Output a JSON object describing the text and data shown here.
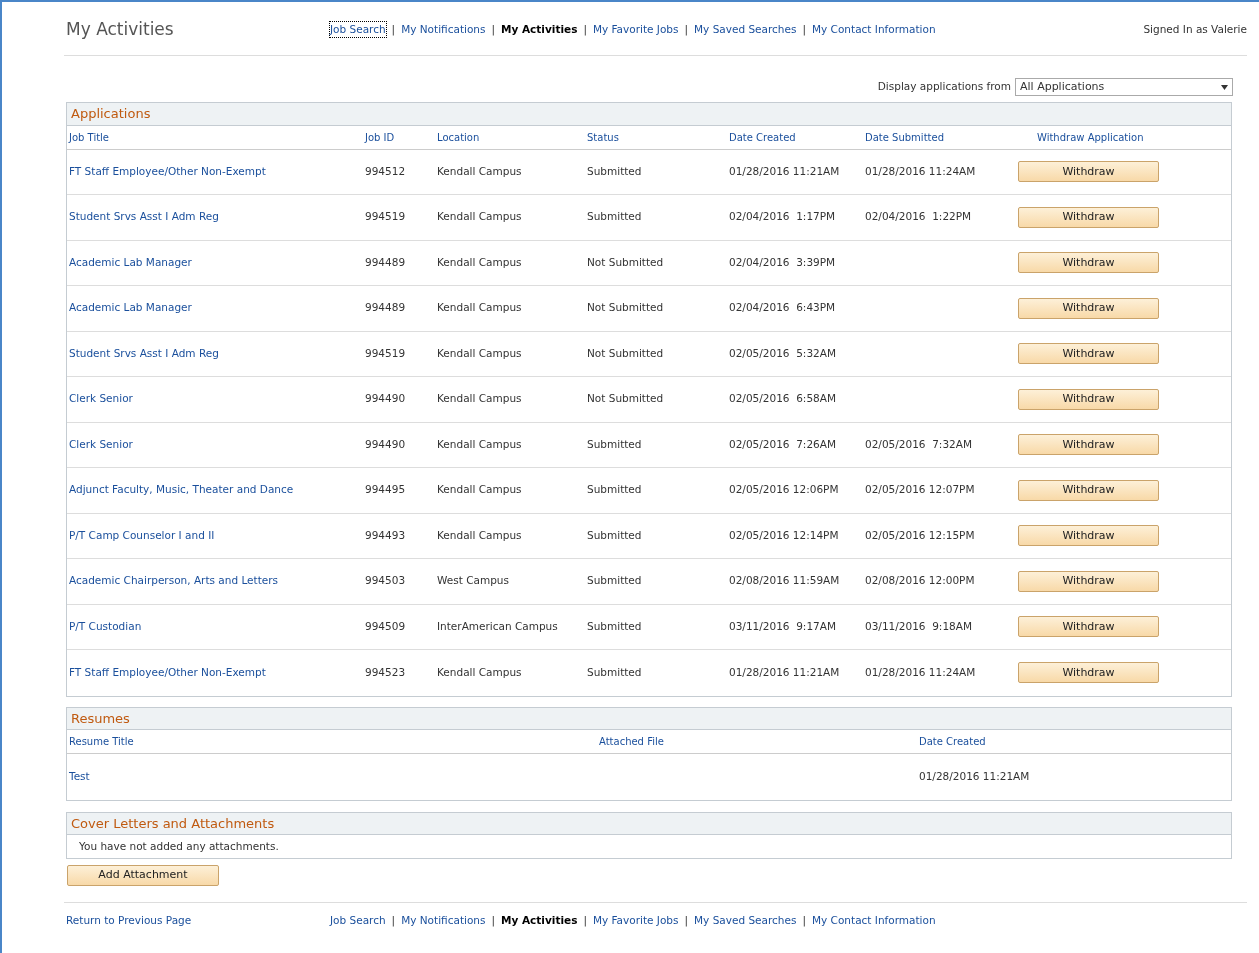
{
  "page_title": "My Activities",
  "top_nav": [
    {
      "label": "Job Search",
      "selected": false,
      "focused": true
    },
    {
      "separator": "|",
      "label": "My Notifications",
      "selected": false,
      "focused": false
    },
    {
      "separator": "|",
      "label": "My Activities",
      "selected": true,
      "focused": false
    },
    {
      "separator": "|",
      "label": "My Favorite Jobs",
      "selected": false,
      "focused": false
    },
    {
      "separator": "|",
      "label": "My Saved Searches",
      "selected": false,
      "focused": false
    },
    {
      "separator": "|",
      "label": "My Contact Information",
      "selected": false,
      "focused": false
    }
  ],
  "signed_in": "Signed In as Valerie",
  "display_filter": {
    "label": "Display applications from",
    "value": "All Applications"
  },
  "applications": {
    "title": "Applications",
    "columns": [
      "Job Title",
      "Job ID",
      "Location",
      "Status",
      "Date Created",
      "Date Submitted",
      "Withdraw Application"
    ],
    "rows": [
      {
        "job_title": "FT Staff Employee/Other Non-Exempt",
        "job_id": "994512",
        "location": "Kendall Campus",
        "status": "Submitted",
        "date_created": "01/28/2016 11:21AM",
        "date_submitted": "01/28/2016 11:24AM",
        "action": "Withdraw"
      },
      {
        "job_title": "Student Srvs Asst I Adm Reg",
        "job_id": "994519",
        "location": "Kendall Campus",
        "status": "Submitted",
        "date_created": "02/04/2016  1:17PM",
        "date_submitted": "02/04/2016  1:22PM",
        "action": "Withdraw"
      },
      {
        "job_title": "Academic Lab Manager",
        "job_id": "994489",
        "location": "Kendall Campus",
        "status": "Not Submitted",
        "date_created": "02/04/2016  3:39PM",
        "action": "Withdraw"
      },
      {
        "job_title": "Academic Lab Manager",
        "job_id": "994489",
        "location": "Kendall Campus",
        "status": "Not Submitted",
        "date_created": "02/04/2016  6:43PM",
        "action": "Withdraw"
      },
      {
        "job_title": "Student Srvs Asst I Adm Reg",
        "job_id": "994519",
        "location": "Kendall Campus",
        "status": "Not Submitted",
        "date_created": "02/05/2016  5:32AM",
        "action": "Withdraw"
      },
      {
        "job_title": "Clerk Senior",
        "job_id": "994490",
        "location": "Kendall Campus",
        "status": "Not Submitted",
        "date_created": "02/05/2016  6:58AM",
        "action": "Withdraw"
      },
      {
        "job_title": "Clerk Senior",
        "job_id": "994490",
        "location": "Kendall Campus",
        "status": "Submitted",
        "date_created": "02/05/2016  7:26AM",
        "date_submitted": "02/05/2016  7:32AM",
        "action": "Withdraw"
      },
      {
        "job_title": "Adjunct Faculty, Music, Theater and Dance",
        "job_id": "994495",
        "location": "Kendall Campus",
        "status": "Submitted",
        "date_created": "02/05/2016 12:06PM",
        "date_submitted": "02/05/2016 12:07PM",
        "action": "Withdraw"
      },
      {
        "job_title": "P/T Camp Counselor I and II",
        "job_id": "994493",
        "location": "Kendall Campus",
        "status": "Submitted",
        "date_created": "02/05/2016 12:14PM",
        "date_submitted": "02/05/2016 12:15PM",
        "action": "Withdraw"
      },
      {
        "job_title": "Academic Chairperson, Arts and Letters",
        "job_id": "994503",
        "location": "West Campus",
        "status": "Submitted",
        "date_created": "02/08/2016 11:59AM",
        "date_submitted": "02/08/2016 12:00PM",
        "action": "Withdraw"
      },
      {
        "job_title": "P/T Custodian",
        "job_id": "994509",
        "location": "InterAmerican Campus",
        "status": "Submitted",
        "date_created": "03/11/2016  9:17AM",
        "date_submitted": "03/11/2016  9:18AM",
        "action": "Withdraw"
      },
      {
        "job_title": "FT Staff Employee/Other Non-Exempt",
        "job_id": "994523",
        "location": "Kendall Campus",
        "status": "Submitted",
        "date_created": "01/28/2016 11:21AM",
        "date_submitted": "01/28/2016 11:24AM",
        "action": "Withdraw"
      }
    ]
  },
  "resumes": {
    "title": "Resumes",
    "columns": [
      "Resume Title",
      "Attached File",
      "Date Created"
    ],
    "rows": [
      {
        "resume_title": "Test",
        "date_created": "01/28/2016 11:21AM"
      }
    ]
  },
  "attachments": {
    "title": "Cover Letters and Attachments",
    "message": "You have not added any attachments."
  },
  "add_button": "Add Attachment",
  "return_link": "Return to Previous Page",
  "bottom_nav": [
    {
      "label": "Job Search",
      "selected": false
    },
    {
      "separator": "|",
      "label": "My Notifications",
      "selected": false
    },
    {
      "separator": "|",
      "label": "My Activities",
      "selected": true
    },
    {
      "separator": "|",
      "label": "My Favorite Jobs",
      "selected": false
    },
    {
      "separator": "|",
      "label": "My Saved Searches",
      "selected": false
    },
    {
      "separator": "|",
      "label": "My Contact Information",
      "selected": false
    }
  ]
}
